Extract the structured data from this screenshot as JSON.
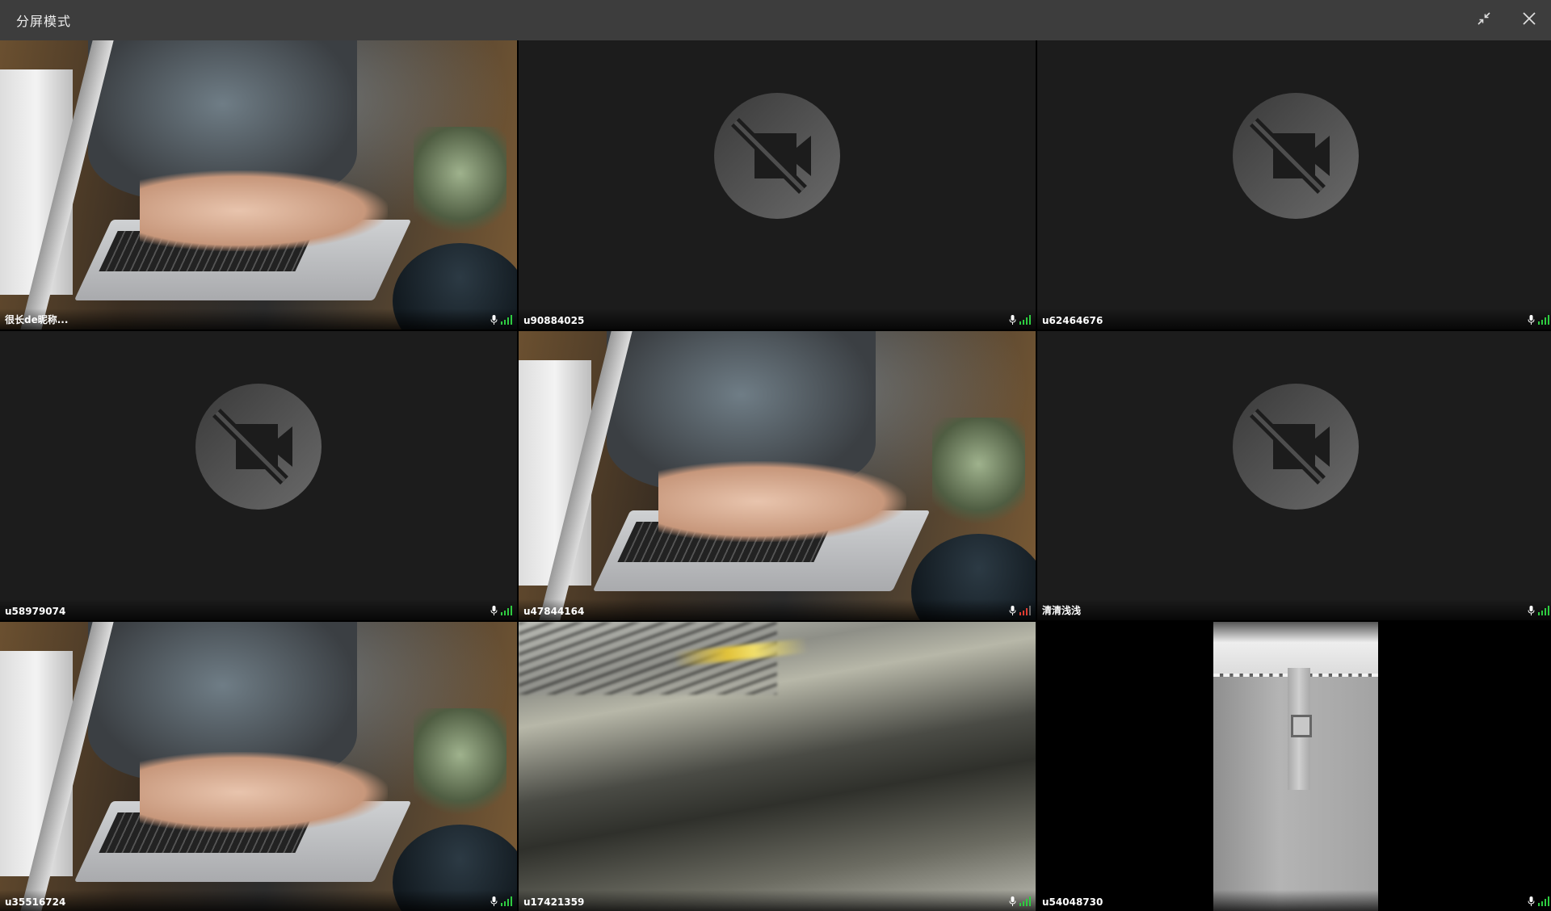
{
  "window": {
    "title": "分屏模式",
    "minimize_icon": "collapse-arrows-icon",
    "close_icon": "close-icon"
  },
  "colors": {
    "titlebar": "#3d3d3d",
    "tile_bg": "#1c1c1c",
    "signal_good": "#2ecc40",
    "signal_bad": "#e03c31",
    "signal_empty": "#6a6a6a"
  },
  "participants": [
    {
      "name": "很长de昵称...",
      "video": "laptop-typing",
      "mic_icon": "microphone-icon",
      "signal": "good"
    },
    {
      "name": "u90884025",
      "video": "camera-off",
      "mic_icon": "microphone-icon",
      "signal": "good"
    },
    {
      "name": "u62464676",
      "video": "camera-off",
      "mic_icon": "microphone-icon",
      "signal": "good"
    },
    {
      "name": "u58979074",
      "video": "camera-off",
      "mic_icon": "microphone-icon",
      "signal": "good"
    },
    {
      "name": "u47844164",
      "video": "laptop-typing",
      "mic_icon": "microphone-icon",
      "signal": "bad"
    },
    {
      "name": "清清浅浅",
      "video": "camera-off",
      "mic_icon": "microphone-icon",
      "signal": "good"
    },
    {
      "name": "u35516724",
      "video": "laptop-typing",
      "mic_icon": "microphone-icon",
      "signal": "good"
    },
    {
      "name": "u17421359",
      "video": "blurred-scene",
      "mic_icon": "microphone-icon",
      "signal": "good"
    },
    {
      "name": "u54048730",
      "video": "door-portrait",
      "mic_icon": "microphone-icon",
      "signal": "good"
    }
  ]
}
